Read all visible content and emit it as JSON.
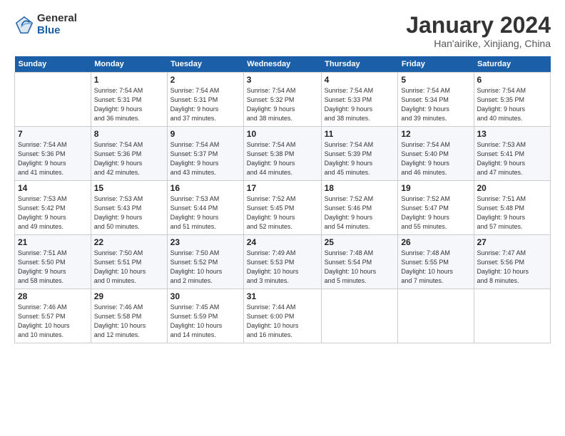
{
  "logo": {
    "general": "General",
    "blue": "Blue"
  },
  "title": "January 2024",
  "location": "Han'airike, Xinjiang, China",
  "days_of_week": [
    "Sunday",
    "Monday",
    "Tuesday",
    "Wednesday",
    "Thursday",
    "Friday",
    "Saturday"
  ],
  "weeks": [
    [
      {
        "day": "",
        "info": ""
      },
      {
        "day": "1",
        "info": "Sunrise: 7:54 AM\nSunset: 5:31 PM\nDaylight: 9 hours\nand 36 minutes."
      },
      {
        "day": "2",
        "info": "Sunrise: 7:54 AM\nSunset: 5:31 PM\nDaylight: 9 hours\nand 37 minutes."
      },
      {
        "day": "3",
        "info": "Sunrise: 7:54 AM\nSunset: 5:32 PM\nDaylight: 9 hours\nand 38 minutes."
      },
      {
        "day": "4",
        "info": "Sunrise: 7:54 AM\nSunset: 5:33 PM\nDaylight: 9 hours\nand 38 minutes."
      },
      {
        "day": "5",
        "info": "Sunrise: 7:54 AM\nSunset: 5:34 PM\nDaylight: 9 hours\nand 39 minutes."
      },
      {
        "day": "6",
        "info": "Sunrise: 7:54 AM\nSunset: 5:35 PM\nDaylight: 9 hours\nand 40 minutes."
      }
    ],
    [
      {
        "day": "7",
        "info": "Sunrise: 7:54 AM\nSunset: 5:36 PM\nDaylight: 9 hours\nand 41 minutes."
      },
      {
        "day": "8",
        "info": "Sunrise: 7:54 AM\nSunset: 5:36 PM\nDaylight: 9 hours\nand 42 minutes."
      },
      {
        "day": "9",
        "info": "Sunrise: 7:54 AM\nSunset: 5:37 PM\nDaylight: 9 hours\nand 43 minutes."
      },
      {
        "day": "10",
        "info": "Sunrise: 7:54 AM\nSunset: 5:38 PM\nDaylight: 9 hours\nand 44 minutes."
      },
      {
        "day": "11",
        "info": "Sunrise: 7:54 AM\nSunset: 5:39 PM\nDaylight: 9 hours\nand 45 minutes."
      },
      {
        "day": "12",
        "info": "Sunrise: 7:54 AM\nSunset: 5:40 PM\nDaylight: 9 hours\nand 46 minutes."
      },
      {
        "day": "13",
        "info": "Sunrise: 7:53 AM\nSunset: 5:41 PM\nDaylight: 9 hours\nand 47 minutes."
      }
    ],
    [
      {
        "day": "14",
        "info": "Sunrise: 7:53 AM\nSunset: 5:42 PM\nDaylight: 9 hours\nand 49 minutes."
      },
      {
        "day": "15",
        "info": "Sunrise: 7:53 AM\nSunset: 5:43 PM\nDaylight: 9 hours\nand 50 minutes."
      },
      {
        "day": "16",
        "info": "Sunrise: 7:53 AM\nSunset: 5:44 PM\nDaylight: 9 hours\nand 51 minutes."
      },
      {
        "day": "17",
        "info": "Sunrise: 7:52 AM\nSunset: 5:45 PM\nDaylight: 9 hours\nand 52 minutes."
      },
      {
        "day": "18",
        "info": "Sunrise: 7:52 AM\nSunset: 5:46 PM\nDaylight: 9 hours\nand 54 minutes."
      },
      {
        "day": "19",
        "info": "Sunrise: 7:52 AM\nSunset: 5:47 PM\nDaylight: 9 hours\nand 55 minutes."
      },
      {
        "day": "20",
        "info": "Sunrise: 7:51 AM\nSunset: 5:48 PM\nDaylight: 9 hours\nand 57 minutes."
      }
    ],
    [
      {
        "day": "21",
        "info": "Sunrise: 7:51 AM\nSunset: 5:50 PM\nDaylight: 9 hours\nand 58 minutes."
      },
      {
        "day": "22",
        "info": "Sunrise: 7:50 AM\nSunset: 5:51 PM\nDaylight: 10 hours\nand 0 minutes."
      },
      {
        "day": "23",
        "info": "Sunrise: 7:50 AM\nSunset: 5:52 PM\nDaylight: 10 hours\nand 2 minutes."
      },
      {
        "day": "24",
        "info": "Sunrise: 7:49 AM\nSunset: 5:53 PM\nDaylight: 10 hours\nand 3 minutes."
      },
      {
        "day": "25",
        "info": "Sunrise: 7:48 AM\nSunset: 5:54 PM\nDaylight: 10 hours\nand 5 minutes."
      },
      {
        "day": "26",
        "info": "Sunrise: 7:48 AM\nSunset: 5:55 PM\nDaylight: 10 hours\nand 7 minutes."
      },
      {
        "day": "27",
        "info": "Sunrise: 7:47 AM\nSunset: 5:56 PM\nDaylight: 10 hours\nand 8 minutes."
      }
    ],
    [
      {
        "day": "28",
        "info": "Sunrise: 7:46 AM\nSunset: 5:57 PM\nDaylight: 10 hours\nand 10 minutes."
      },
      {
        "day": "29",
        "info": "Sunrise: 7:46 AM\nSunset: 5:58 PM\nDaylight: 10 hours\nand 12 minutes."
      },
      {
        "day": "30",
        "info": "Sunrise: 7:45 AM\nSunset: 5:59 PM\nDaylight: 10 hours\nand 14 minutes."
      },
      {
        "day": "31",
        "info": "Sunrise: 7:44 AM\nSunset: 6:00 PM\nDaylight: 10 hours\nand 16 minutes."
      },
      {
        "day": "",
        "info": ""
      },
      {
        "day": "",
        "info": ""
      },
      {
        "day": "",
        "info": ""
      }
    ]
  ]
}
